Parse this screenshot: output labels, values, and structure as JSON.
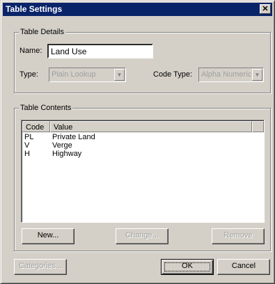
{
  "window": {
    "title": "Table Settings",
    "close_glyph": "✕"
  },
  "details": {
    "legend": "Table Details",
    "name_label": "Name:",
    "name_value": "Land Use",
    "type_label": "Type:",
    "type_value": "Plain Lookup",
    "code_type_label": "Code Type:",
    "code_type_value": "Alpha Numeric"
  },
  "contents": {
    "legend": "Table Contents",
    "columns": [
      "Code",
      "Value"
    ],
    "rows": [
      {
        "code": "PL",
        "value": "Private Land"
      },
      {
        "code": "V",
        "value": "Verge"
      },
      {
        "code": "H",
        "value": "Highway"
      }
    ],
    "new_label": "New...",
    "change_label": "Change...",
    "remove_label": "Remove"
  },
  "footer": {
    "categories_label": "Categories...",
    "ok_label": "OK",
    "cancel_label": "Cancel"
  }
}
